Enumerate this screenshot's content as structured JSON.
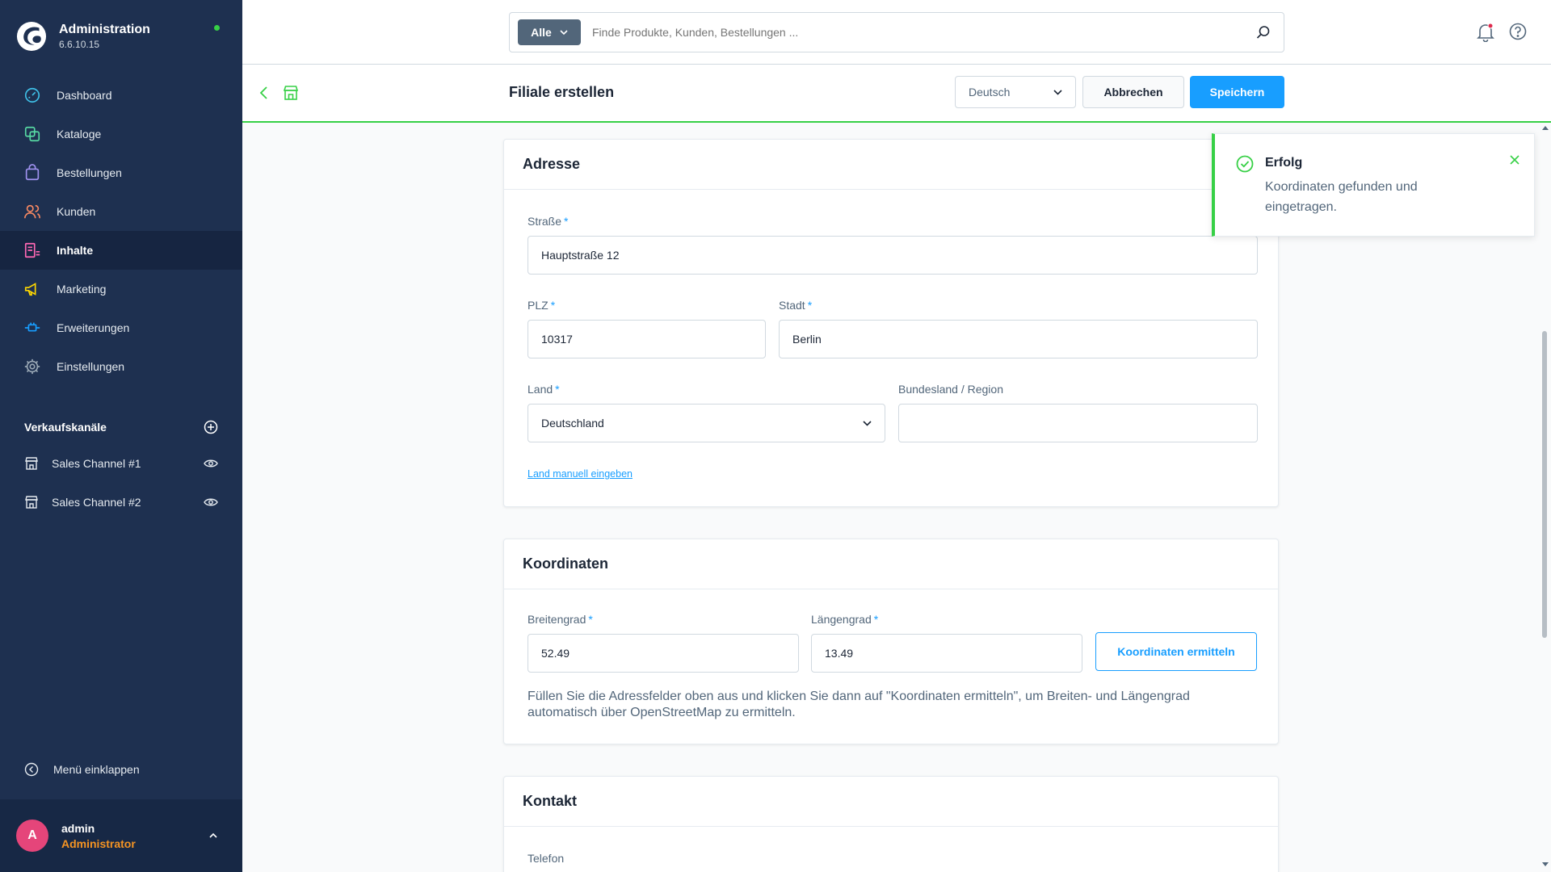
{
  "brand": {
    "title": "Administration",
    "version": "6.6.10.15"
  },
  "sidebar": {
    "items": [
      {
        "label": "Dashboard",
        "icon": "dashboard-icon"
      },
      {
        "label": "Kataloge",
        "icon": "catalog-icon"
      },
      {
        "label": "Bestellungen",
        "icon": "orders-icon"
      },
      {
        "label": "Kunden",
        "icon": "customers-icon"
      },
      {
        "label": "Inhalte",
        "icon": "content-icon",
        "active": true
      },
      {
        "label": "Marketing",
        "icon": "megaphone-icon"
      },
      {
        "label": "Erweiterungen",
        "icon": "plug-icon"
      },
      {
        "label": "Einstellungen",
        "icon": "gear-icon"
      }
    ],
    "sales_channels_title": "Verkaufskanäle",
    "sales_channels": [
      {
        "label": "Sales Channel #1"
      },
      {
        "label": "Sales Channel #2"
      }
    ],
    "collapse_label": "Menü einklappen",
    "user": {
      "initial": "A",
      "name": "admin",
      "role": "Administrator"
    }
  },
  "search": {
    "type_label": "Alle",
    "placeholder": "Finde Produkte, Kunden, Bestellungen ..."
  },
  "smartbar": {
    "title": "Filiale erstellen",
    "language": "Deutsch",
    "cancel_label": "Abbrechen",
    "save_label": "Speichern"
  },
  "address": {
    "title": "Adresse",
    "street_label": "Straße",
    "street_value": "Hauptstraße 12",
    "zip_label": "PLZ",
    "zip_value": "10317",
    "city_label": "Stadt",
    "city_value": "Berlin",
    "country_label": "Land",
    "country_value": "Deutschland",
    "region_label": "Bundesland / Region",
    "region_value": "",
    "manual_link": "Land manuell eingeben"
  },
  "coordinates": {
    "title": "Koordinaten",
    "lat_label": "Breitengrad",
    "lat_value": "52.49",
    "lng_label": "Längengrad",
    "lng_value": "13.49",
    "button_label": "Koordinaten ermitteln",
    "help_text": "Füllen Sie die Adressfelder oben aus und klicken Sie dann auf \"Koordinaten ermitteln\", um Breiten- und Längengrad automatisch über OpenStreetMap zu ermitteln."
  },
  "contact": {
    "title": "Kontakt",
    "phone_label": "Telefon"
  },
  "toast": {
    "title": "Erfolg",
    "message": "Koordinaten gefunden und eingetragen."
  },
  "colors": {
    "sidebar": "#1e3050",
    "accent": "#189eff",
    "success": "#37d046",
    "role": "#f59423",
    "avatar": "#e5457a"
  }
}
